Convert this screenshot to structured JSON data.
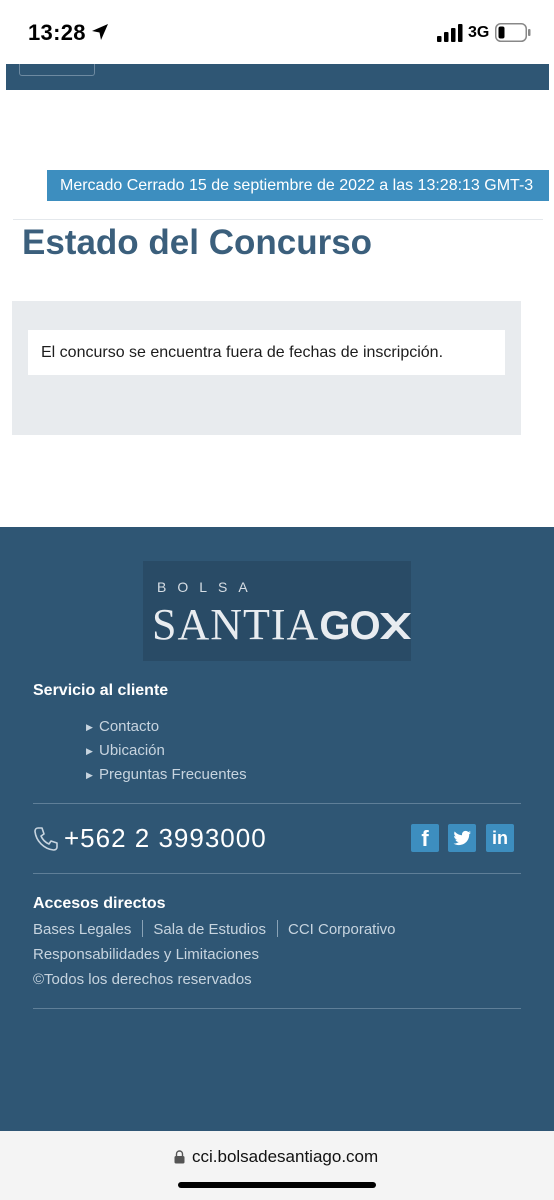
{
  "status_bar": {
    "time": "13:28",
    "network": "3G",
    "location_icon": "location-arrow-icon",
    "signal_icon": "signal-bars-icon",
    "battery_icon": "battery-low-icon"
  },
  "market_status": "Mercado Cerrado 15 de septiembre de 2022 a las 13:28:13 GMT-3",
  "page": {
    "title": "Estado del Concurso",
    "notice": "El concurso se encuentra fuera de fechas de inscripción."
  },
  "footer": {
    "logo": {
      "top_word": "BOLSA",
      "main_word": "SANTIA",
      "main_word_mark": "GO"
    },
    "service": {
      "heading": "Servicio al cliente",
      "links": [
        "Contacto",
        "Ubicación",
        "Preguntas Frecuentes"
      ]
    },
    "phone": "+562 2 3993000",
    "social": {
      "facebook": "f",
      "linkedin": "in"
    },
    "direct_access": {
      "heading": "Accesos directos",
      "links": [
        "Bases Legales",
        "Sala de Estudios",
        "CCI Corporativo",
        "Responsabilidades y Limitaciones"
      ]
    },
    "copyright": "©Todos los derechos reservados"
  },
  "browser": {
    "url": "cci.bolsadesantiago.com"
  },
  "colors": {
    "header_blue": "#2f5674",
    "accent_blue": "#3d8ebf",
    "title_blue": "#3b5f7c"
  }
}
